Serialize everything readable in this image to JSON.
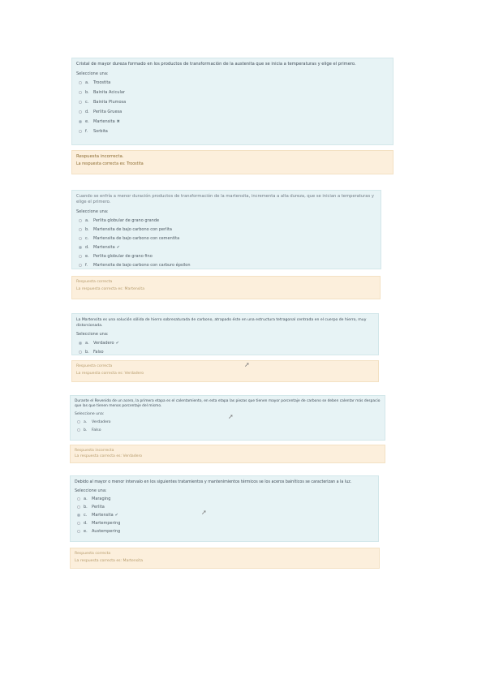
{
  "questions": [
    {
      "text": "Cristal de mayor dureza formado en los productos de transformación de la austenita que se inicia a temperaturas y elige el primero.",
      "select_label": "Seleccione una:",
      "options": [
        {
          "letter": "a.",
          "label": "Troostita",
          "selected": false,
          "mark": ""
        },
        {
          "letter": "b.",
          "label": "Bainita Acicular",
          "selected": false,
          "mark": ""
        },
        {
          "letter": "c.",
          "label": "Bainita Plumosa",
          "selected": false,
          "mark": ""
        },
        {
          "letter": "d.",
          "label": "Perlita Gruesa",
          "selected": false,
          "mark": ""
        },
        {
          "letter": "e.",
          "label": "Martensita",
          "selected": true,
          "mark": "✖"
        },
        {
          "letter": "f.",
          "label": "Sorbita",
          "selected": false,
          "mark": ""
        }
      ],
      "feedback_title": "Respuesta incorrecta.",
      "feedback_text": "La respuesta correcta es: Troostita"
    },
    {
      "text": "Cuando se enfría a menor duración productos de transformación de la martensita, incrementa a alta dureza, que se inician a temperaturas y elige el primero.",
      "select_label": "Seleccione una:",
      "options": [
        {
          "letter": "a.",
          "label": "Perlita globular de grano grande",
          "selected": false,
          "mark": ""
        },
        {
          "letter": "b.",
          "label": "Martensita de bajo carbono con perlita",
          "selected": false,
          "mark": ""
        },
        {
          "letter": "c.",
          "label": "Martensita de bajo carbono con cementita",
          "selected": false,
          "mark": ""
        },
        {
          "letter": "d.",
          "label": "Martensita",
          "selected": true,
          "mark": "✔"
        },
        {
          "letter": "e.",
          "label": "Perlita globular de grano fino",
          "selected": false,
          "mark": ""
        },
        {
          "letter": "f.",
          "label": "Martensita de bajo carbono con carburo épsilon",
          "selected": false,
          "mark": ""
        }
      ],
      "feedback_title": "Respuesta correcta",
      "feedback_text": "La respuesta correcta es: Martensita"
    },
    {
      "text": "La Martensita es una solución sólida de hierro sobresaturada de carbono, atrapado éste en una estructura tetragonal centrada en el cuerpo de hierro, muy distorsionada.",
      "select_label": "Seleccione una:",
      "options": [
        {
          "letter": "a.",
          "label": "Verdadero",
          "selected": true,
          "mark": "✔"
        },
        {
          "letter": "b.",
          "label": "Falso",
          "selected": false,
          "mark": ""
        }
      ],
      "feedback_title": "Respuesta correcta",
      "feedback_text": "La respuesta correcta es: Verdadero"
    },
    {
      "text": "Durante el Revenido de un acero, la primera etapa es el calentamiento, en esta etapa las piezas que tienen mayor porcentaje de carbono se deben calentar más despacio que las que tienen menos porcentaje del mismo.",
      "select_label": "Seleccione una:",
      "options": [
        {
          "letter": "a.",
          "label": "Verdadero",
          "selected": false,
          "mark": ""
        },
        {
          "letter": "b.",
          "label": "Falso",
          "selected": false,
          "mark": ""
        }
      ],
      "feedback_title": "Respuesta incorrecta",
      "feedback_text": "La respuesta correcta es: Verdadero"
    },
    {
      "text": "Debido al mayor o menor intervalo en los siguientes tratamientos y mantenimientos térmicos se los aceros bainíticos se caracterizan a la luz.",
      "select_label": "Seleccione una:",
      "options": [
        {
          "letter": "a.",
          "label": "Maraging",
          "selected": false,
          "mark": ""
        },
        {
          "letter": "b.",
          "label": "Perlita",
          "selected": false,
          "mark": ""
        },
        {
          "letter": "c.",
          "label": "Martensita",
          "selected": true,
          "mark": "✔"
        },
        {
          "letter": "d.",
          "label": "Martempering",
          "selected": false,
          "mark": ""
        },
        {
          "letter": "e.",
          "label": "Austempering",
          "selected": false,
          "mark": ""
        }
      ],
      "feedback_title": "Respuesta correcta",
      "feedback_text": "La respuesta correcta es: Martensita"
    }
  ],
  "colors": {
    "question_bg": "#e7f3f5",
    "feedback_bg": "#fcefdc",
    "feedback_text": "#8b6a2f"
  }
}
